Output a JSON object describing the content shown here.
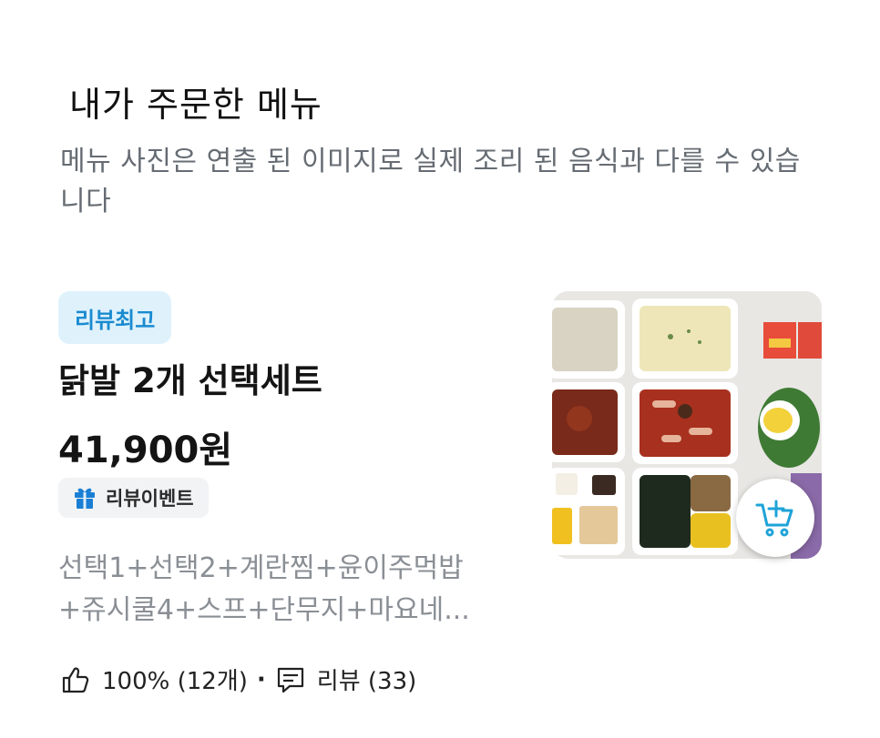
{
  "section": {
    "title": "내가 주문한 메뉴",
    "description": "메뉴 사진은 연출 된 이미지로 실제 조리 된 음식과 다를 수 있습니다"
  },
  "menu": {
    "badge": "리뷰최고",
    "name": "닭발 2개 선택세트",
    "price": "41,900원",
    "event_badge": "리뷰이벤트",
    "description_line1": "선택1+선택2+계란찜+윤이주먹밥",
    "description_line2": "+쥬시쿨4+스프+단무지+마요네...",
    "like_rate": "100% (12개)",
    "separator": "·",
    "review_label": "리뷰 (33)",
    "image_alt": "닭발 2개 선택세트 사진"
  },
  "colors": {
    "badge_best_bg": "#dff2fc",
    "badge_best_text": "#1a8bd0",
    "cart_icon": "#1ea3d8",
    "gift_icon": "#1a7fd4"
  },
  "icons": {
    "gift": "gift-icon",
    "thumbs_up": "thumbs-up-icon",
    "review": "speech-bubble-icon",
    "cart": "cart-add-icon"
  }
}
